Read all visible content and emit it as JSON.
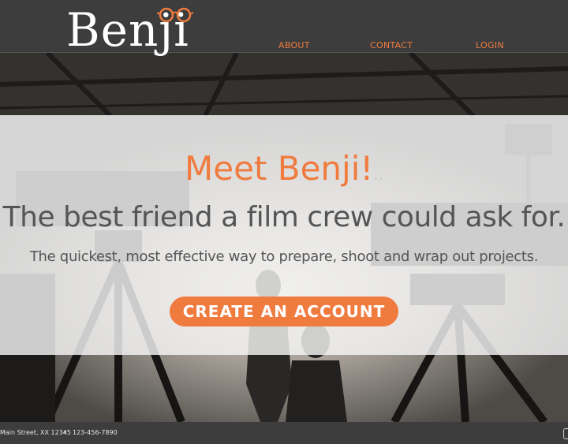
{
  "brand": {
    "logo_text": "Benji",
    "accent_color": "#f07b3f"
  },
  "nav": {
    "about": "ABOUT",
    "contact": "CONTACT",
    "login": "LOGIN"
  },
  "hero": {
    "title": "Meet Benji!",
    "title_suffix": "..",
    "subtitle": "The best friend a film crew could ask for.",
    "description": "The quickest, most effective way to prepare, shoot and wrap out projects.",
    "cta_label": "CREATE AN ACCOUNT"
  },
  "footer": {
    "address": "Main Street, XX 12345",
    "separator": "•",
    "phone": "123-456-7890"
  }
}
